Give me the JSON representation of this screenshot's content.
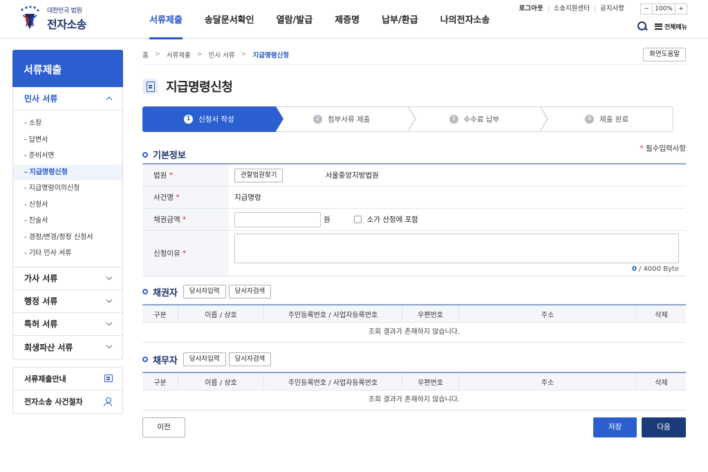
{
  "header": {
    "logo_top": "대한민국 법원",
    "logo_main": "전자소송",
    "nav": [
      "서류제출",
      "송달문서확인",
      "열람/발급",
      "제증명",
      "납부/환급",
      "나의전자소송"
    ],
    "util": [
      "로그아웃",
      "소송지원센터",
      "공지사항"
    ],
    "zoom_minus": "−",
    "zoom_value": "100%",
    "zoom_plus": "+",
    "all_menu": "전체메뉴"
  },
  "sidebar": {
    "title": "서류제출",
    "open_section": "민사 서류",
    "sub_items": [
      "- 소장",
      "- 답변서",
      "- 준비서면",
      "- 지급명령신청",
      "- 지급명령이의신청",
      "- 신청서",
      "- 진술서",
      "- 경정/변경/정정 신청서",
      "- 기타 민사 서류"
    ],
    "sections": [
      "가사 서류",
      "행정 서류",
      "특허 서류",
      "회생파산 서류"
    ],
    "extra": [
      "서류제출안내",
      "전자소송 사건절차"
    ]
  },
  "breadcrumb": [
    "홈",
    "서류제출",
    "민사 서류",
    "지급명령신청"
  ],
  "breadcrumb_sep": ">",
  "help_button": "화면도움말",
  "page_title": "지급명령신청",
  "steps": [
    {
      "num": "1",
      "label": "신청서 작성"
    },
    {
      "num": "2",
      "label": "첨부서류 제출"
    },
    {
      "num": "3",
      "label": "수수료 납부"
    },
    {
      "num": "4",
      "label": "제출 완료"
    }
  ],
  "basic": {
    "title": "기본정보",
    "required_note": "필수입력사항",
    "required_mark": "*",
    "court_label": "법원",
    "court_button": "관할법원찾기",
    "court_value": "서울중앙지방법원",
    "case_label": "사건명",
    "case_value": "지급명령",
    "amount_label": "채권금액",
    "amount_value": "",
    "amount_unit": "원",
    "small_claim_label": "소가 산정에 포함",
    "reason_label": "신청이유",
    "reason_value": "",
    "byte_count": "0",
    "byte_limit": " / 4000 Byte"
  },
  "creditor": {
    "title": "채권자",
    "btn_input": "당사자입력",
    "btn_search": "당사자검색",
    "columns": [
      "구분",
      "이름 / 상호",
      "주민등록번호 / 사업자등록번호",
      "우편번호",
      "주소",
      "삭제"
    ],
    "empty": "조회 결과가 존재하지 않습니다."
  },
  "debtor": {
    "title": "채무자",
    "btn_input": "당사자입력",
    "btn_search": "당사자검색",
    "columns": [
      "구분",
      "이름 / 상호",
      "주민등록번호 / 사업자등록번호",
      "우편번호",
      "주소",
      "삭제"
    ],
    "empty": "조회 결과가 존재하지 않습니다."
  },
  "actions": {
    "prev": "이전",
    "save": "저장",
    "next": "다음"
  },
  "colors": {
    "primary": "#2b5fd0",
    "dark": "#1b3a7a",
    "required": "#d6282b"
  }
}
